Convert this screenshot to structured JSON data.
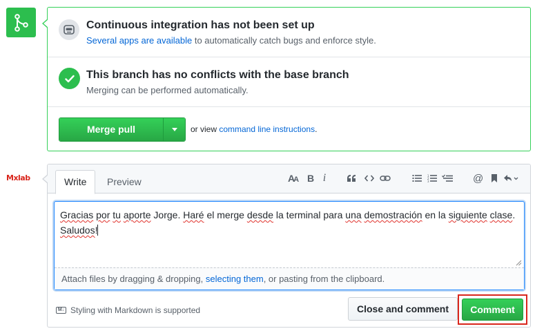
{
  "status_icon": "git-merge-icon",
  "ci": {
    "icon": "hubot-icon",
    "title": "Continuous integration has not been set up",
    "link_text": "Several apps are available",
    "rest_text": " to automatically catch bugs and enforce style."
  },
  "conflicts": {
    "icon": "check-icon",
    "title": "This branch has no conflicts with the base branch",
    "subtitle": "Merging can be performed automatically."
  },
  "merge": {
    "button_label": "Merge pull request",
    "caret_icon": "triangle-down-icon",
    "or_view": "or view ",
    "cli_link": "command line instructions",
    "period": "."
  },
  "avatar": {
    "text": "Mxlab"
  },
  "comment": {
    "tabs": [
      "Write",
      "Preview"
    ],
    "toolbar": [
      "text-size-icon",
      "bold-icon",
      "italic-icon",
      "quote-icon",
      "code-icon",
      "link-icon",
      "unordered-list-icon",
      "ordered-list-icon",
      "task-list-icon",
      "mention-icon",
      "bookmark-icon",
      "reply-icon"
    ],
    "text_parts": [
      {
        "t": "Gracias",
        "spell": true
      },
      {
        "t": " ",
        "spell": false
      },
      {
        "t": "por",
        "spell": true
      },
      {
        "t": " ",
        "spell": false
      },
      {
        "t": "tu",
        "spell": true
      },
      {
        "t": " ",
        "spell": false
      },
      {
        "t": "aporte",
        "spell": true
      },
      {
        "t": " Jorge. ",
        "spell": false
      },
      {
        "t": "Haré",
        "spell": true
      },
      {
        "t": " el merge ",
        "spell": false
      },
      {
        "t": "desde",
        "spell": true
      },
      {
        "t": " la terminal para ",
        "spell": false
      },
      {
        "t": "una",
        "spell": true
      },
      {
        "t": " ",
        "spell": false
      },
      {
        "t": "demostración",
        "spell": true
      },
      {
        "t": " en la ",
        "spell": false
      },
      {
        "t": "siguiente",
        "spell": true
      },
      {
        "t": " ",
        "spell": false
      },
      {
        "t": "clase",
        "spell": true
      },
      {
        "t": ". ",
        "spell": false
      },
      {
        "t": "Saludos",
        "spell": true
      },
      {
        "t": "!",
        "spell": false
      }
    ],
    "attach_prefix": "Attach files by dragging & dropping, ",
    "attach_link": "selecting them",
    "attach_suffix": ", or pasting from the clipboard.",
    "markdown_note": "Styling with Markdown is supported",
    "markdown_icon": "markdown-icon",
    "close_button": "Close and comment",
    "comment_button": "Comment"
  },
  "colors": {
    "success": "#2cbe4e",
    "link": "#0366d6",
    "highlight": "#d9261c"
  }
}
